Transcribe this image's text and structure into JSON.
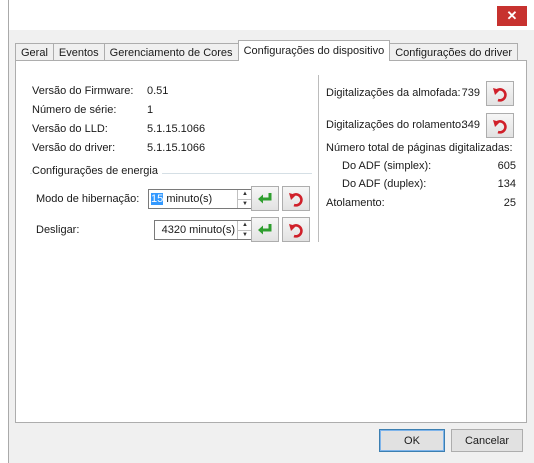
{
  "window": {
    "close_glyph": "✕"
  },
  "tabs": [
    "Geral",
    "Eventos",
    "Gerenciamento de Cores",
    "Configurações do dispositivo",
    "Configurações do driver"
  ],
  "active_tab": 3,
  "device_info": [
    {
      "label": "Versão do Firmware:",
      "value": "0.51"
    },
    {
      "label": "Número de série:",
      "value": "1"
    },
    {
      "label": "Versão do LLD:",
      "value": "5.1.15.1066"
    },
    {
      "label": "Versão do driver:",
      "value": "5.1.15.1066"
    }
  ],
  "power": {
    "title": "Configurações de energia",
    "sleep": {
      "label": "Modo de hibernação:",
      "value_selected": "15",
      "unit": "minuto(s)"
    },
    "off": {
      "label": "Desligar:",
      "value": "4320 minuto(s)"
    }
  },
  "counters": {
    "pad": {
      "label": "Digitalizações da almofada:",
      "value": "739"
    },
    "roller": {
      "label": "Digitalizações do rolamento:",
      "value": "349"
    },
    "total_title": "Número total de páginas digitalizadas:",
    "simplex": {
      "label": "Do ADF (simplex):",
      "value": "605"
    },
    "duplex": {
      "label": "Do ADF (duplex):",
      "value": "134"
    },
    "jam": {
      "label": "Atolamento:",
      "value": "25"
    }
  },
  "buttons": {
    "ok": "OK",
    "cancel": "Cancelar"
  },
  "icons": {
    "apply": "green-enter-arrow-icon",
    "reset": "red-undo-arrow-icon"
  },
  "colors": {
    "close": "#c7322f",
    "apply": "#2e9e2e",
    "reset": "#d0202a",
    "selection": "#3399ff"
  }
}
